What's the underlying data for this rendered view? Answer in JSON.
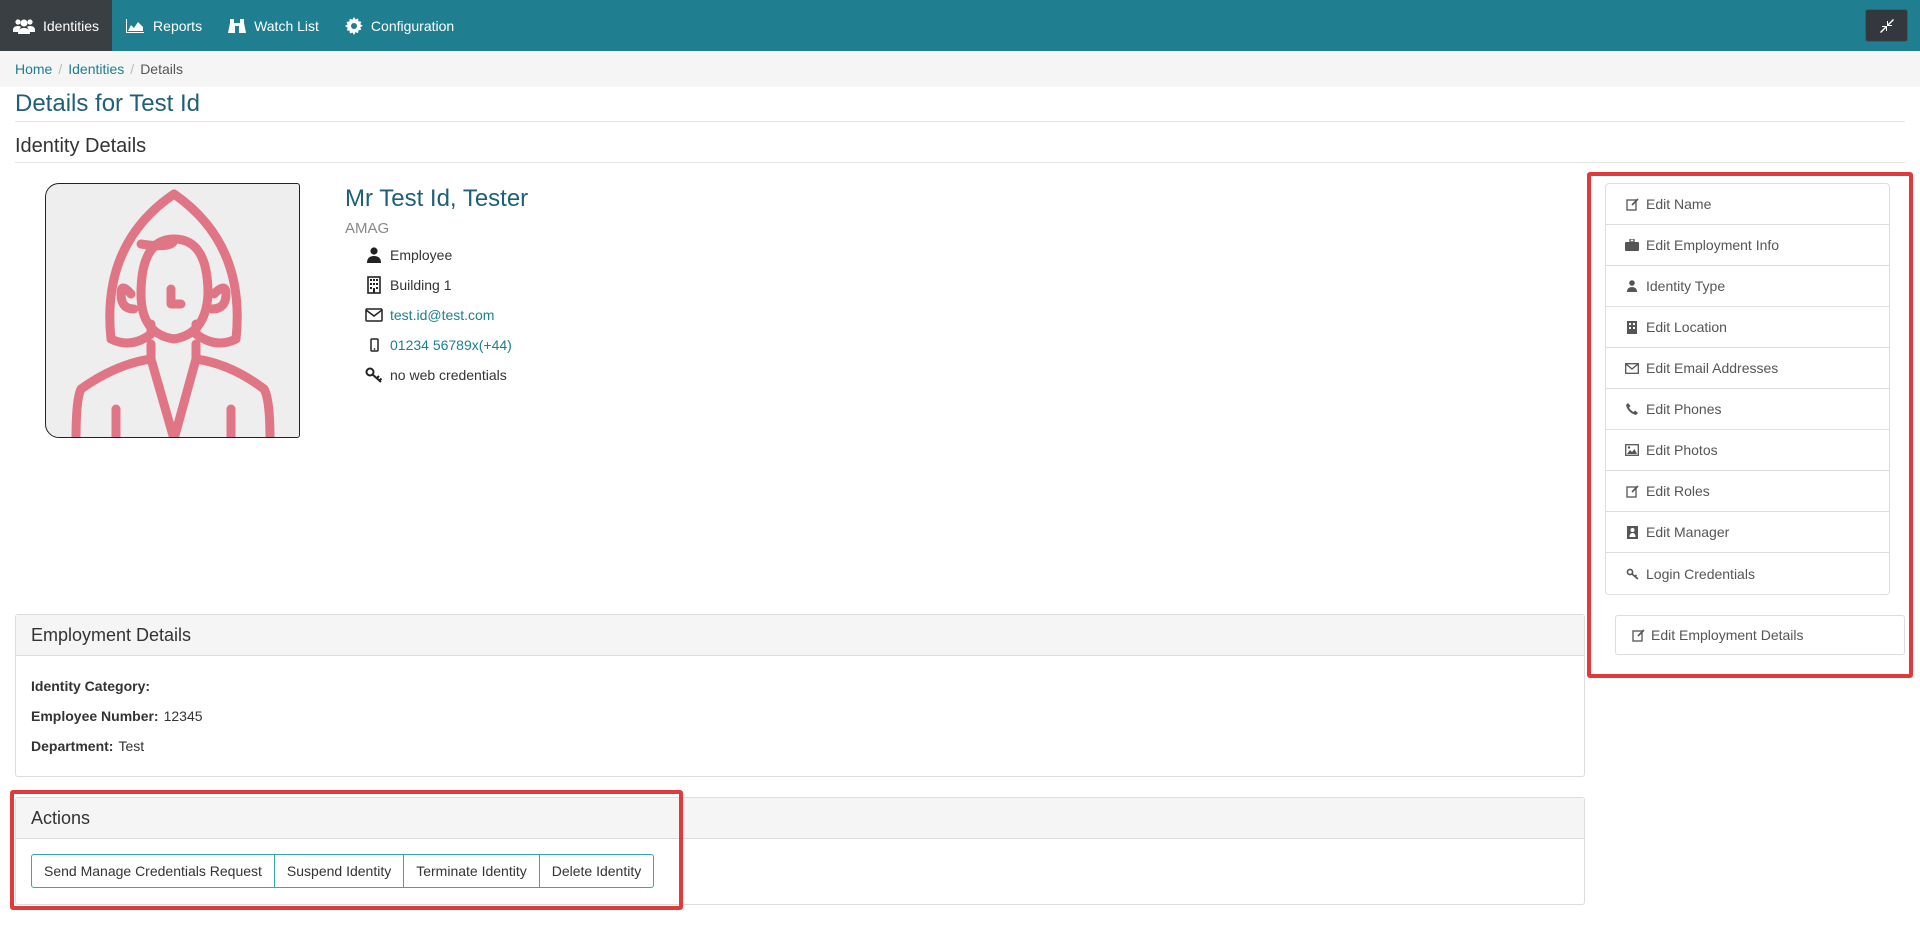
{
  "nav": {
    "items": [
      {
        "label": "Identities",
        "icon": "users-icon"
      },
      {
        "label": "Reports",
        "icon": "area-chart-icon"
      },
      {
        "label": "Watch List",
        "icon": "binoculars-icon"
      },
      {
        "label": "Configuration",
        "icon": "gear-icon"
      }
    ],
    "collapse_icon": "compress-icon"
  },
  "breadcrumb": {
    "home": "Home",
    "identities": "Identities",
    "current": "Details"
  },
  "page_title": "Details for Test Id",
  "section_title": "Identity Details",
  "identity": {
    "name": "Mr Test Id, Tester",
    "org": "AMAG",
    "type": "Employee",
    "location": "Building 1",
    "email": "test.id@test.com",
    "phone": "01234 56789x(+44)",
    "credentials": "no web credentials"
  },
  "side_menu": {
    "items": [
      {
        "label": "Edit Name",
        "icon": "edit-icon"
      },
      {
        "label": "Edit Employment Info",
        "icon": "briefcase-icon"
      },
      {
        "label": "Identity Type",
        "icon": "user-icon"
      },
      {
        "label": "Edit Location",
        "icon": "building-icon"
      },
      {
        "label": "Edit Email Addresses",
        "icon": "envelope-icon"
      },
      {
        "label": "Edit Phones",
        "icon": "phone-icon"
      },
      {
        "label": "Edit Photos",
        "icon": "image-icon"
      },
      {
        "label": "Edit Roles",
        "icon": "edit-icon"
      },
      {
        "label": "Edit Manager",
        "icon": "manager-icon"
      },
      {
        "label": "Login Credentials",
        "icon": "key-icon"
      }
    ],
    "edit_employment_details": "Edit Employment Details"
  },
  "employment": {
    "title": "Employment Details",
    "category_label": "Identity Category:",
    "category_value": "",
    "number_label": "Employee Number:",
    "number_value": "12345",
    "department_label": "Department:",
    "department_value": "Test"
  },
  "actions": {
    "title": "Actions",
    "buttons": [
      "Send Manage Credentials Request",
      "Suspend Identity",
      "Terminate Identity",
      "Delete Identity"
    ]
  },
  "colors": {
    "navbar": "#1f7e8f",
    "highlight": "#e03a3a",
    "avatar": "#e07585"
  }
}
